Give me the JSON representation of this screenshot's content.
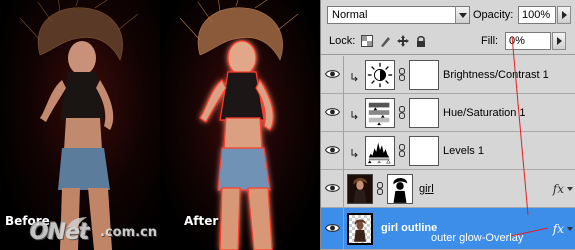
{
  "photos": {
    "before_label": "Before",
    "after_label": "After",
    "watermark": "ONet",
    "watermark_domain": ".com.cn"
  },
  "panel": {
    "blend_mode": "Normal",
    "opacity_label": "Opacity:",
    "opacity_value": "100%",
    "lock_label": "Lock:",
    "fill_label": "Fill:",
    "fill_value": "0%",
    "layers": [
      {
        "name": "Brightness/Contrast 1",
        "type": "adjustment",
        "icon": "brightness-contrast-icon",
        "visible": true,
        "clipped": true
      },
      {
        "name": "Hue/Saturation 1",
        "type": "adjustment",
        "icon": "hue-saturation-icon",
        "visible": true,
        "clipped": true
      },
      {
        "name": "Levels 1",
        "type": "adjustment",
        "icon": "levels-icon",
        "visible": true,
        "clipped": true
      },
      {
        "name": "girl",
        "type": "pixel",
        "visible": true,
        "has_mask": true,
        "fx": "fx"
      },
      {
        "name": "girl outline",
        "type": "pixel",
        "visible": true,
        "selected": true,
        "fx": "fx"
      }
    ],
    "annotation": "outer glow-Overlay"
  },
  "colors": {
    "selection": "#3d8ee8",
    "panel_bg": "#d6d6d6",
    "annotation_line": "#e02020"
  }
}
